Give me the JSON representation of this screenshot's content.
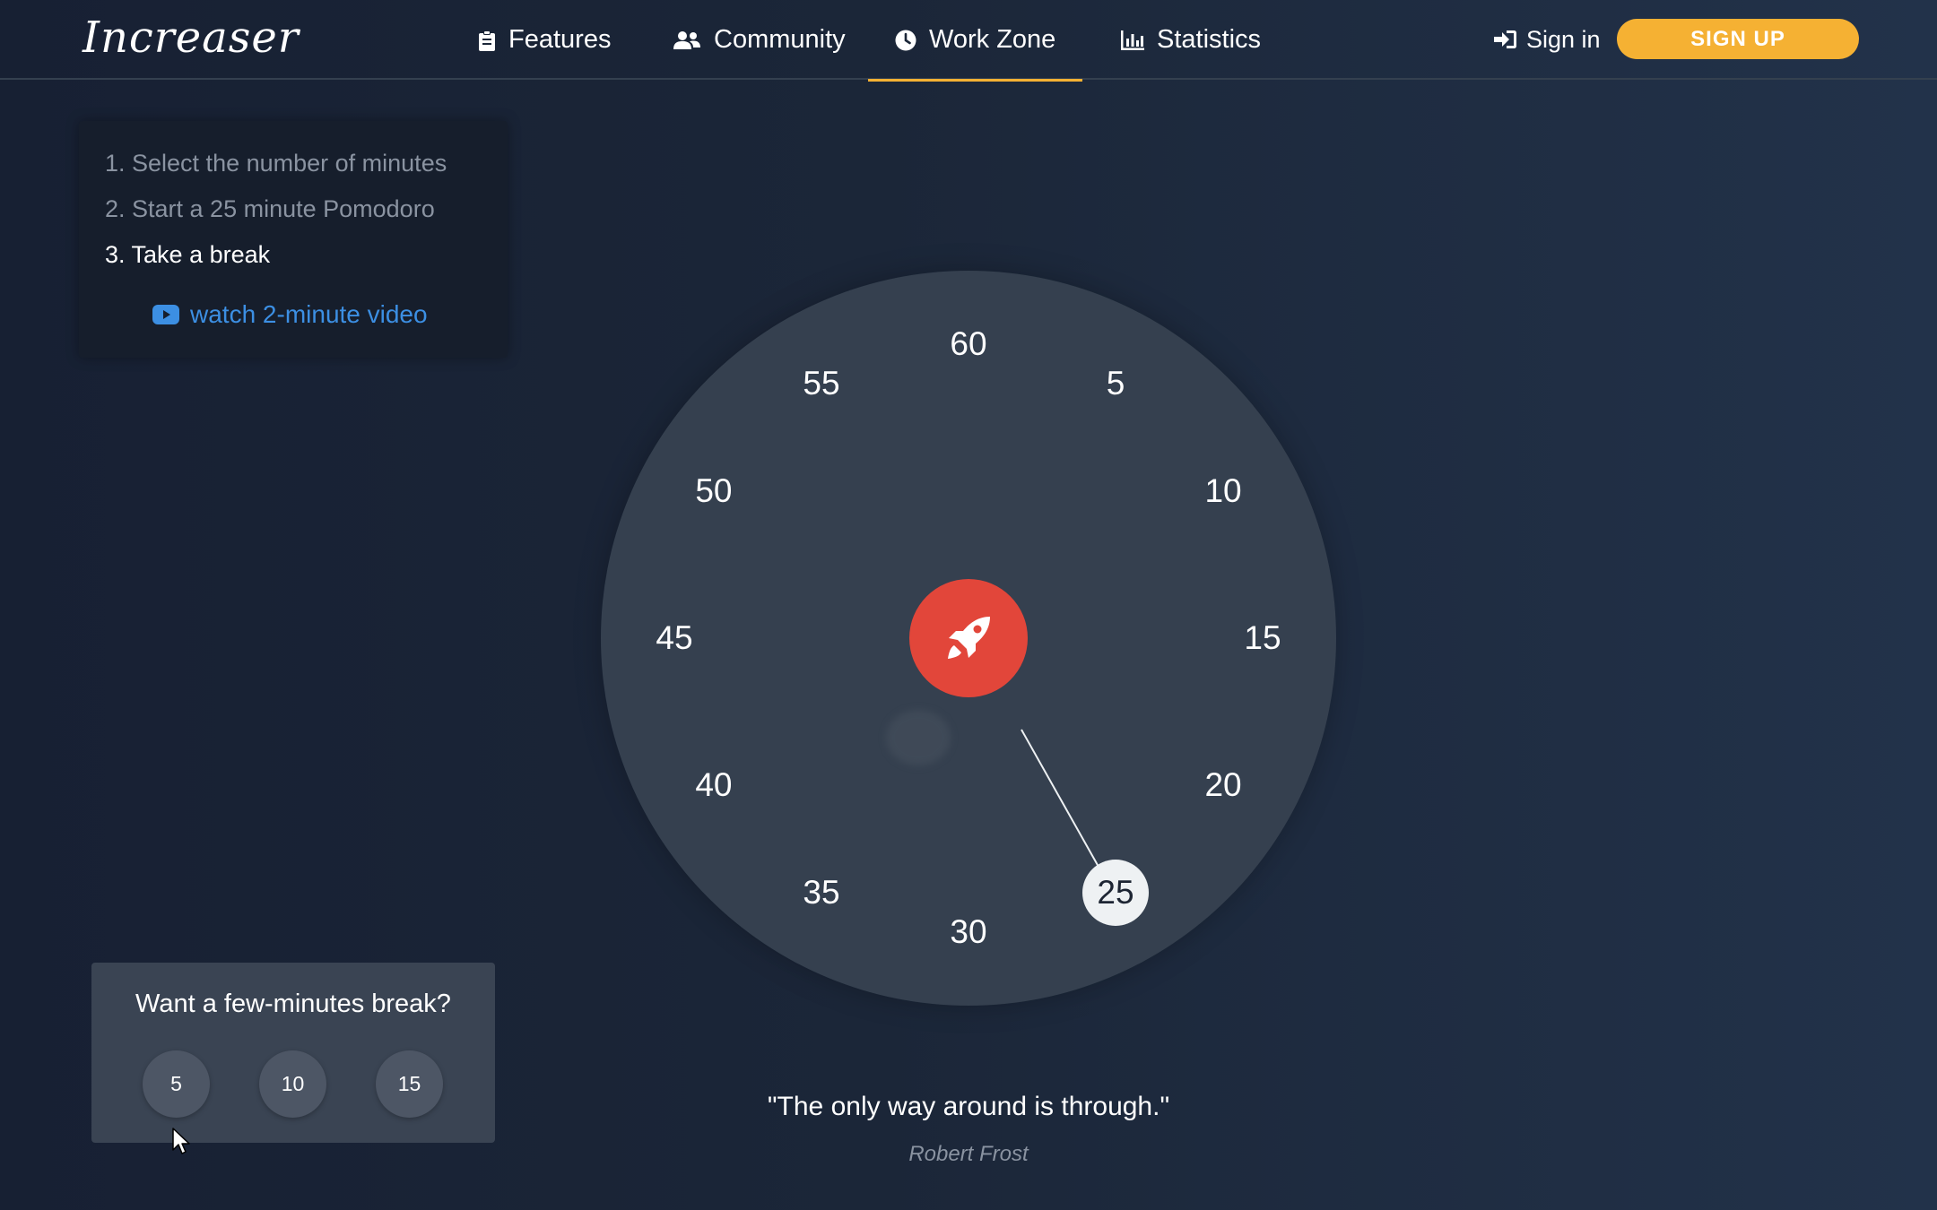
{
  "header": {
    "logo": "Increaser",
    "nav": [
      {
        "label": "Features",
        "icon": "clipboard-icon"
      },
      {
        "label": "Community",
        "icon": "users-icon"
      },
      {
        "label": "Work Zone",
        "icon": "clock-icon",
        "active": true
      },
      {
        "label": "Statistics",
        "icon": "bar-chart-icon"
      }
    ],
    "sign_in": "Sign in",
    "sign_up": "SIGN UP"
  },
  "steps": {
    "items": [
      {
        "text": "1. Select the number of minutes",
        "current": false
      },
      {
        "text": "2. Start a 25 minute Pomodoro",
        "current": false
      },
      {
        "text": "3. Take a break",
        "current": true
      }
    ],
    "video_link": "watch 2-minute video"
  },
  "dial": {
    "labels": [
      "60",
      "5",
      "10",
      "15",
      "20",
      "25",
      "30",
      "35",
      "40",
      "45",
      "50",
      "55"
    ],
    "selected_minutes": "25",
    "start_icon": "rocket-icon"
  },
  "break": {
    "title": "Want a few-minutes break?",
    "options": [
      "5",
      "10",
      "15"
    ]
  },
  "quote": {
    "text": "\"The only way around is through.\"",
    "author": "Robert Frost"
  },
  "colors": {
    "accent": "#f5b133",
    "start_button": "#e2463a",
    "link": "#3c8fe3",
    "dial": "#35404f"
  }
}
